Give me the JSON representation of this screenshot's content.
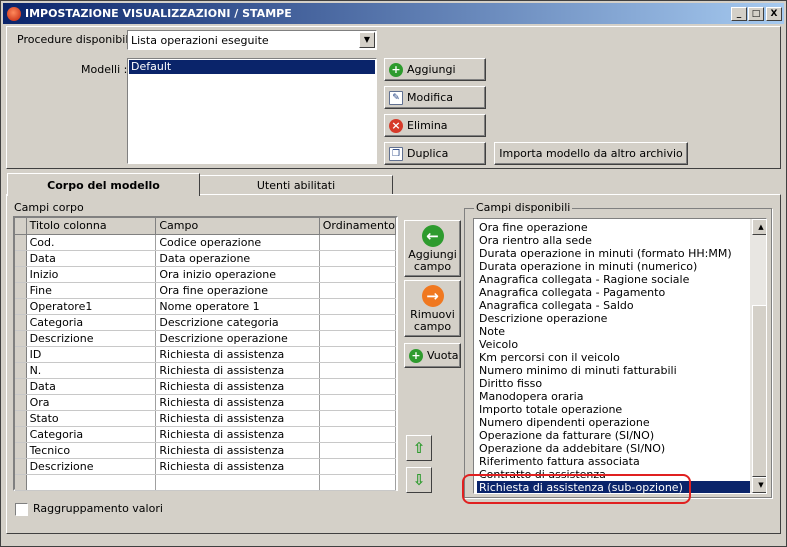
{
  "window": {
    "title": "IMPOSTAZIONE VISUALIZZAZIONI / STAMPE",
    "minimize": "_",
    "maximize": "□",
    "close": "X"
  },
  "procedure": {
    "label": "Procedure disponibili :",
    "value": "Lista operazioni eseguite"
  },
  "modelli": {
    "label": "Modelli :",
    "items": [
      "Default"
    ]
  },
  "buttons": {
    "aggiungi": "Aggiungi",
    "modifica": "Modifica",
    "elimina": "Elimina",
    "duplica": "Duplica",
    "importa": "Importa modello da altro archivio"
  },
  "tabs": [
    "Corpo del modello",
    "Utenti abilitati"
  ],
  "campi_corpo": {
    "label": "Campi corpo",
    "columns": [
      "Titolo colonna",
      "Campo",
      "Ordinamento"
    ],
    "rows": [
      [
        "Cod.",
        "Codice operazione",
        ""
      ],
      [
        "Data",
        "Data operazione",
        ""
      ],
      [
        "Inizio",
        "Ora inizio operazione",
        ""
      ],
      [
        "Fine",
        "Ora fine operazione",
        ""
      ],
      [
        "Operatore1",
        "Nome operatore 1",
        ""
      ],
      [
        "Categoria",
        "Descrizione categoria",
        ""
      ],
      [
        "Descrizione",
        "Descrizione operazione",
        ""
      ],
      [
        "ID",
        "Richiesta di assistenza",
        ""
      ],
      [
        "N.",
        "Richiesta di assistenza",
        ""
      ],
      [
        "Data",
        "Richiesta di assistenza",
        ""
      ],
      [
        "Ora",
        "Richiesta di assistenza",
        ""
      ],
      [
        "Stato",
        "Richiesta di assistenza",
        ""
      ],
      [
        "Categoria",
        "Richiesta di assistenza",
        ""
      ],
      [
        "Tecnico",
        "Richiesta di assistenza",
        ""
      ],
      [
        "Descrizione",
        "Richiesta di assistenza",
        ""
      ]
    ]
  },
  "mid_buttons": {
    "aggiungi_campo": "Aggiungi campo",
    "rimuovi_campo": "Rimuovi campo",
    "vuota": "Vuota"
  },
  "campi_disponibili": {
    "label": "Campi disponibili",
    "items": [
      "Ora fine operazione",
      "Ora rientro alla sede",
      "Durata operazione in minuti (formato HH:MM)",
      "Durata operazione in minuti (numerico)",
      "Anagrafica collegata - Ragione sociale",
      "Anagrafica collegata - Pagamento",
      "Anagrafica collegata - Saldo",
      "Descrizione operazione",
      "Note",
      "Veicolo",
      "Km percorsi con il veicolo",
      "Numero minimo di minuti fatturabili",
      "Diritto fisso",
      "Manodopera oraria",
      "Importo totale operazione",
      "Numero dipendenti operazione",
      "Operazione da fatturare (SI/NO)",
      "Operazione da addebitare (SI/NO)",
      "Riferimento fattura associata",
      "Contratto di assistenza",
      "Richiesta di assistenza (sub-opzione)"
    ],
    "selected_index": 20
  },
  "raggruppamento": {
    "label": "Raggruppamento valori",
    "checked": false
  },
  "colors": {
    "title_start": "#0a246a",
    "selection": "#0a246a",
    "highlight": "#e02020"
  }
}
